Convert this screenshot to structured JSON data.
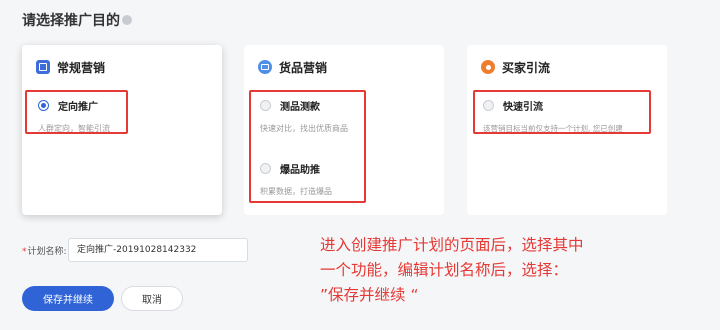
{
  "page": {
    "title": "请选择推广目的"
  },
  "cards": [
    {
      "title": "常规营销",
      "icon": "grid-icon",
      "options": [
        {
          "label": "定向推广",
          "desc": "人群定向，智能引流",
          "checked": true
        }
      ]
    },
    {
      "title": "货品营销",
      "icon": "goods-icon",
      "options": [
        {
          "label": "测品测款",
          "desc": "快速对比，找出优质商品",
          "checked": false
        },
        {
          "label": "爆品助推",
          "desc": "积累数据，打造爆品",
          "checked": false
        }
      ]
    },
    {
      "title": "买家引流",
      "icon": "user-icon",
      "options": [
        {
          "label": "快速引流",
          "desc": "该营销目标当前仅支持一个计划, 您已创建",
          "checked": false
        }
      ]
    }
  ],
  "plan_name": {
    "label": "计划名称:",
    "required_mark": "*",
    "value": "定向推广-20191028142332"
  },
  "buttons": {
    "save_continue": "保存并继续",
    "cancel": "取消"
  },
  "annotation": {
    "line1": "进入创建推广计划的页面后，选择其中",
    "line2": "一个功能，编辑计划名称后，选择：",
    "line3": "”保存并继续 “"
  },
  "colors": {
    "primary": "#2f63d6",
    "annotation_red": "#e53935"
  }
}
